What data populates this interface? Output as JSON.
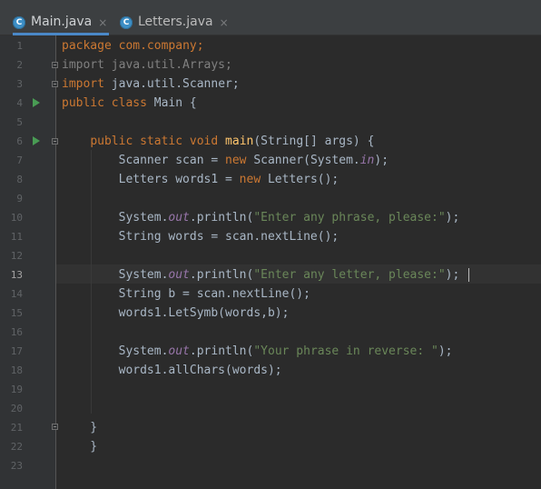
{
  "tabs": [
    {
      "icon": "C",
      "label": "Main.java",
      "close": "×",
      "active": true
    },
    {
      "icon": "C",
      "label": "Letters.java",
      "close": "×",
      "active": false
    }
  ],
  "line_numbers": [
    "1",
    "2",
    "3",
    "4",
    "5",
    "6",
    "7",
    "8",
    "9",
    "10",
    "11",
    "12",
    "13",
    "14",
    "15",
    "16",
    "17",
    "18",
    "19",
    "20",
    "21",
    "22",
    "23"
  ],
  "current_line": "13",
  "code": {
    "l1": [
      "package",
      " com.company;"
    ],
    "l2": [
      "import java.util.Arrays;"
    ],
    "l3": [
      "import",
      " java.util.Scanner;"
    ],
    "l4": [
      "public",
      " ",
      "class",
      " Main {"
    ],
    "l6": [
      "    ",
      "public",
      " ",
      "static",
      " ",
      "void",
      " ",
      "main",
      "(String[] args) {"
    ],
    "l7": [
      "        Scanner scan = ",
      "new",
      " Scanner(System.",
      "in",
      ");"
    ],
    "l8": [
      "        Letters words1 = ",
      "new",
      " Letters();"
    ],
    "l10": [
      "        System.",
      "out",
      ".println(",
      "\"Enter any phrase, please:\"",
      ");"
    ],
    "l11": [
      "        String words = scan.nextLine();"
    ],
    "l13": [
      "        System.",
      "out",
      ".println(",
      "\"Enter any letter, please:\"",
      ");"
    ],
    "l14": [
      "        String b = scan.nextLine();"
    ],
    "l15": [
      "        words1.LetSymb(words,b);"
    ],
    "l17": [
      "        System.",
      "out",
      ".println(",
      "\"Your phrase in reverse: \"",
      ");"
    ],
    "l18": [
      "        words1.allChars(words);"
    ],
    "l21": [
      "    }"
    ],
    "l22": [
      "    }"
    ]
  },
  "icons": {
    "tab_file": "java-class-icon",
    "run": "run-arrow-icon",
    "fold": "fold-marker-icon"
  },
  "colors": {
    "background": "#2b2b2b",
    "keyword": "#cc7832",
    "method": "#ffc66d",
    "string": "#6a8759",
    "field": "#9876aa",
    "text": "#a9b7c6",
    "tab_accent": "#4a88c7",
    "run_icon": "#499c54"
  }
}
